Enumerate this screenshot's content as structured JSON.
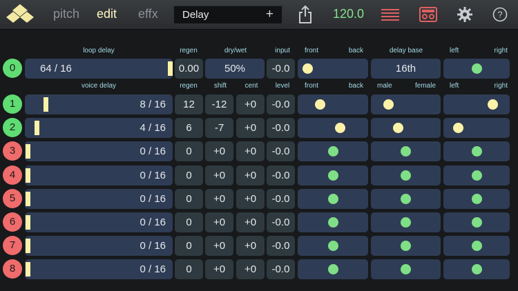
{
  "toolbar": {
    "tabs": [
      "pitch",
      "edit",
      "effx"
    ],
    "preset_name": "Delay",
    "preset_add": "+",
    "tempo": "120.0"
  },
  "loop_headers": [
    "loop delay",
    "regen",
    "dry/wet",
    "input",
    "front",
    "back",
    "delay base",
    "left",
    "right"
  ],
  "loop_row": {
    "badge": "0",
    "delay": "64 / 16",
    "delay_fraction": 1.0,
    "regen": "0.00",
    "dry_wet": "50%",
    "input": "-0.0",
    "front_back": 0.0,
    "delay_base": "16th",
    "left_right": 0.5
  },
  "voice_headers": [
    "voice delay",
    "regen",
    "shift",
    "cent",
    "level",
    "front",
    "back",
    "male",
    "female",
    "left",
    "right"
  ],
  "voice_rows": [
    {
      "badge": "1",
      "delay": "8 / 16",
      "delay_fraction": 0.125,
      "regen": "12",
      "shift": "-12",
      "cent": "+0",
      "level": "-0.0",
      "front_back": 0.25,
      "male_female": 0.15,
      "left_right": 0.85,
      "active": true
    },
    {
      "badge": "2",
      "delay": "4 / 16",
      "delay_fraction": 0.0625,
      "regen": "6",
      "shift": "-7",
      "cent": "+0",
      "level": "-0.0",
      "front_back": 0.65,
      "male_female": 0.35,
      "left_right": 0.1,
      "active": true
    },
    {
      "badge": "3",
      "delay": "0 / 16",
      "delay_fraction": 0,
      "regen": "0",
      "shift": "+0",
      "cent": "+0",
      "level": "-0.0",
      "front_back": 0.5,
      "male_female": 0.5,
      "left_right": 0.5,
      "active": false
    },
    {
      "badge": "4",
      "delay": "0 / 16",
      "delay_fraction": 0,
      "regen": "0",
      "shift": "+0",
      "cent": "+0",
      "level": "-0.0",
      "front_back": 0.5,
      "male_female": 0.5,
      "left_right": 0.5,
      "active": false
    },
    {
      "badge": "5",
      "delay": "0 / 16",
      "delay_fraction": 0,
      "regen": "0",
      "shift": "+0",
      "cent": "+0",
      "level": "-0.0",
      "front_back": 0.5,
      "male_female": 0.5,
      "left_right": 0.5,
      "active": false
    },
    {
      "badge": "6",
      "delay": "0 / 16",
      "delay_fraction": 0,
      "regen": "0",
      "shift": "+0",
      "cent": "+0",
      "level": "-0.0",
      "front_back": 0.5,
      "male_female": 0.5,
      "left_right": 0.5,
      "active": false
    },
    {
      "badge": "7",
      "delay": "0 / 16",
      "delay_fraction": 0,
      "regen": "0",
      "shift": "+0",
      "cent": "+0",
      "level": "-0.0",
      "front_back": 0.5,
      "male_female": 0.5,
      "left_right": 0.5,
      "active": false
    },
    {
      "badge": "8",
      "delay": "0 / 16",
      "delay_fraction": 0,
      "regen": "0",
      "shift": "+0",
      "cent": "+0",
      "level": "-0.0",
      "front_back": 0.5,
      "male_female": 0.5,
      "left_right": 0.5,
      "active": false
    }
  ],
  "colors": {
    "accent_yellow": "#fbf2a8",
    "active_green": "#5fdc72",
    "inactive_red": "#f06b6b",
    "tempo_green": "#86e08c",
    "record_red": "#f06b6b"
  },
  "icons": [
    "app-logo-icon",
    "share-icon",
    "mixer-lines-icon",
    "tape-recorder-icon",
    "gear-icon",
    "help-icon"
  ]
}
